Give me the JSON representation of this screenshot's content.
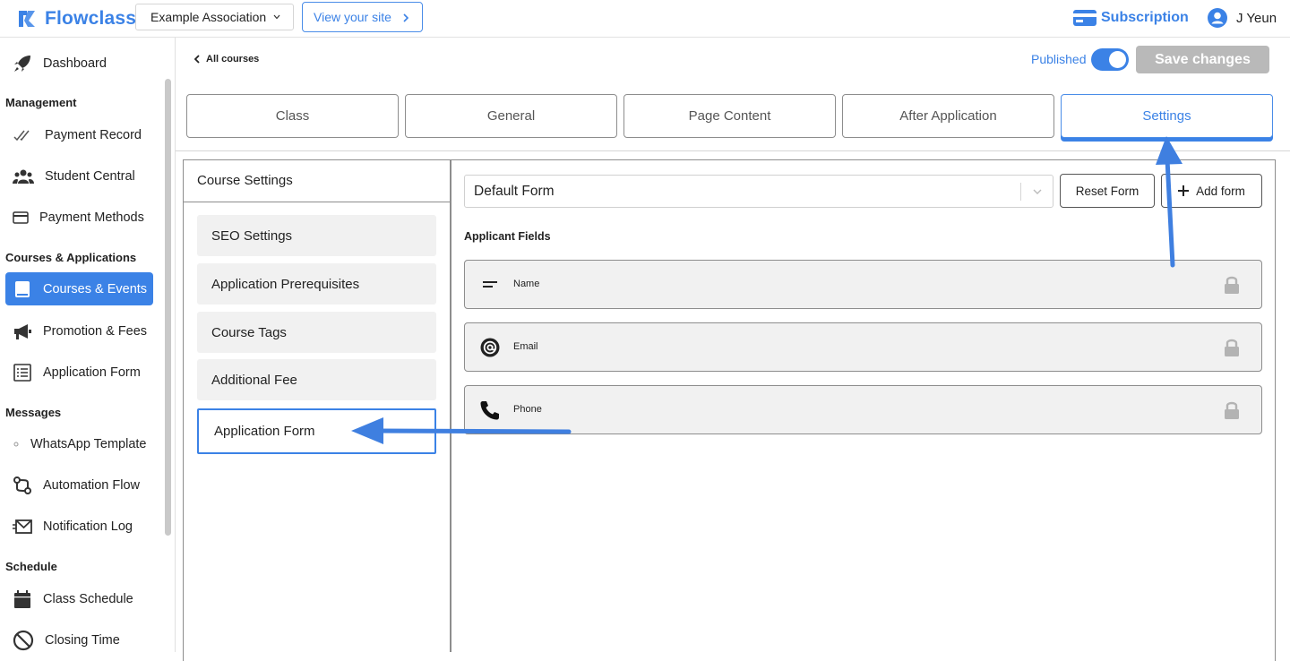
{
  "header": {
    "brand": "Flowclass",
    "org_name": "Example Association",
    "view_site_label": "View your site",
    "subscription_label": "Subscription",
    "user_name": "J Yeun"
  },
  "sidebar": {
    "dashboard": "Dashboard",
    "sections": {
      "management": "Management",
      "courses": "Courses & Applications",
      "messages": "Messages",
      "schedule": "Schedule"
    },
    "items": {
      "payment_record": "Payment Record",
      "student_central": "Student Central",
      "payment_methods": "Payment Methods",
      "courses_events": "Courses & Events",
      "promotion_fees": "Promotion & Fees",
      "application_form": "Application Form",
      "whatsapp_template": "WhatsApp Template",
      "automation_flow": "Automation Flow",
      "notification_log": "Notification Log",
      "class_schedule": "Class Schedule",
      "closing_time": "Closing Time"
    },
    "active_item": "Courses & Events"
  },
  "page": {
    "back_label": "All courses",
    "published_label": "Published",
    "published": true,
    "save_label": "Save changes"
  },
  "tabs": [
    "Class",
    "General",
    "Page Content",
    "After Application",
    "Settings"
  ],
  "selected_tab": "Settings",
  "course_settings": {
    "title": "Course Settings",
    "items": [
      "SEO Settings",
      "Application Prerequisites",
      "Course Tags",
      "Additional Fee",
      "Application Form"
    ],
    "selected": "Application Form"
  },
  "form_panel": {
    "selected_form": "Default Form",
    "reset_label": "Reset Form",
    "add_label": "Add form",
    "fields_heading": "Applicant Fields",
    "fields": [
      {
        "label": "Name",
        "icon": "text-lines-icon",
        "locked": true
      },
      {
        "label": "Email",
        "icon": "at-sign-icon",
        "locked": true
      },
      {
        "label": "Phone",
        "icon": "phone-icon",
        "locked": true
      }
    ]
  },
  "colors": {
    "accent": "#3b82e6",
    "save_disabled": "#b9b9b9",
    "field_bg": "#f1f1f1",
    "border": "#8d8d8d"
  }
}
